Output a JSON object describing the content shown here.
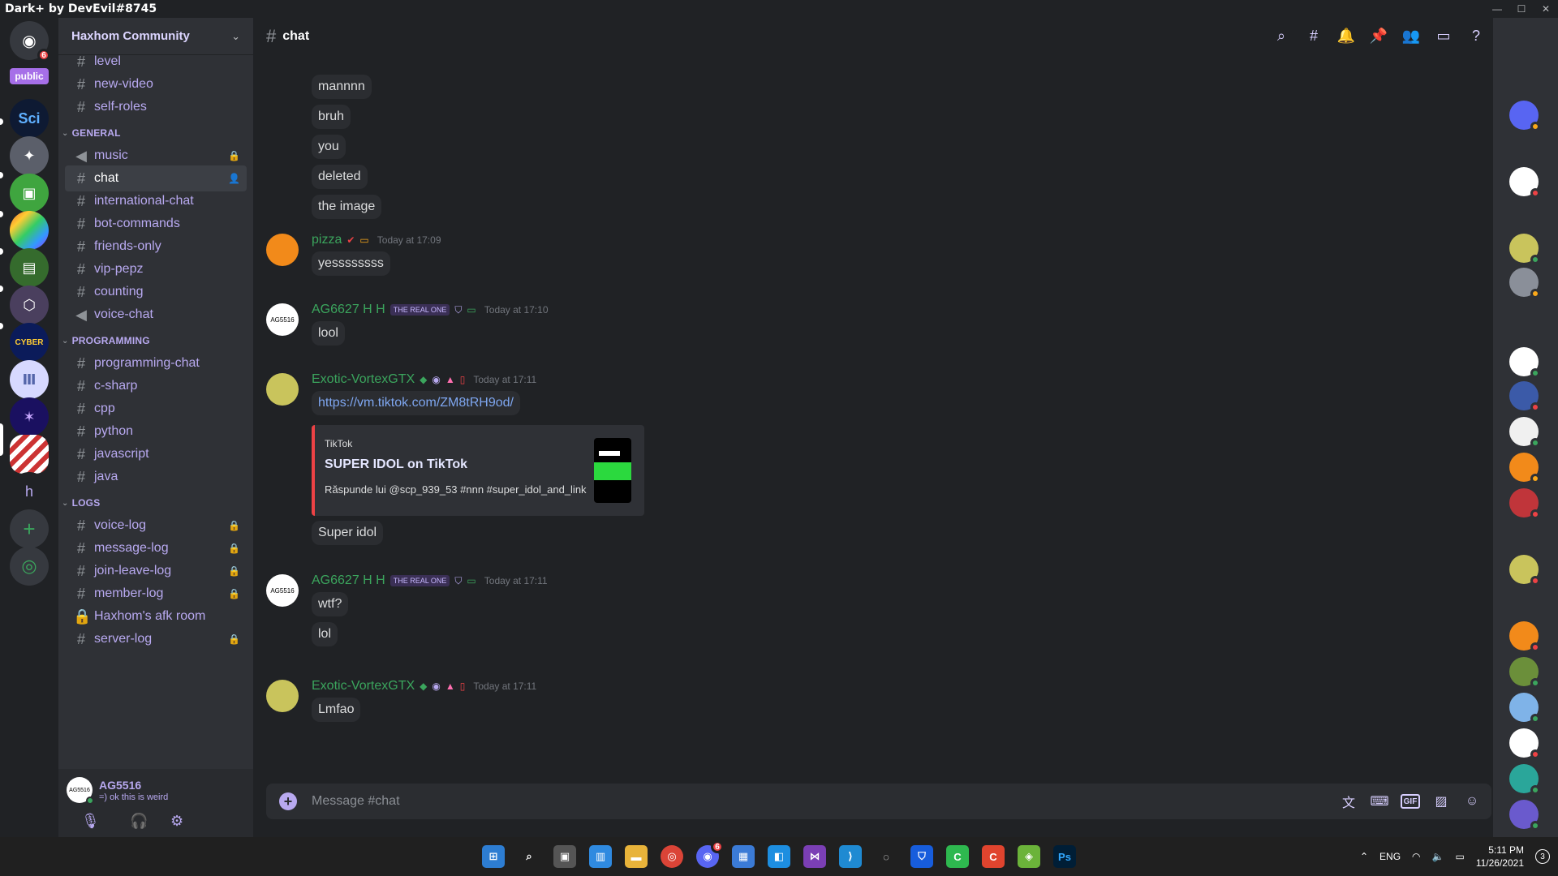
{
  "window": {
    "title": "Dark+ by DevEvil#8745"
  },
  "rail": {
    "home_badge": "6",
    "public_label": "public",
    "text_server_initial": "h",
    "add_label": "+",
    "explore_label": "◎"
  },
  "sidebar": {
    "guild_name": "Haxhom Community",
    "top_channels": [
      "level",
      "new-video",
      "self-roles"
    ],
    "categories": [
      {
        "name": "GENERAL"
      },
      {
        "name": "PROGRAMMING"
      },
      {
        "name": "LOGS"
      }
    ],
    "general": [
      "music",
      "chat",
      "international-chat",
      "bot-commands",
      "friends-only",
      "vip-pepz",
      "counting",
      "voice-chat"
    ],
    "programming": [
      "programming-chat",
      "c-sharp",
      "cpp",
      "python",
      "javascript",
      "java"
    ],
    "logs": [
      "voice-log",
      "message-log",
      "join-leave-log",
      "member-log",
      "Haxhom's afk room",
      "server-log"
    ]
  },
  "user": {
    "name": "AG5516",
    "status": "=) ok this is weird",
    "avatar_text": "AG5516"
  },
  "chat": {
    "channel_name": "chat",
    "bubbles_top": [
      "mannnn",
      "bruh",
      "you",
      "deleted",
      "the image"
    ],
    "msg_pizza": {
      "author": "pizza",
      "time": "Today at 17:09",
      "text": "yessssssss"
    },
    "msg_ag1": {
      "author": "AG6627 H H",
      "tag": "THE REAL ONE",
      "time": "Today at 17:10",
      "text": "lool",
      "avatar_text": "AG5516"
    },
    "msg_exotic1": {
      "author": "Exotic-VortexGTX",
      "time": "Today at 17:11",
      "link": "https://vm.tiktok.com/ZM8tRH9od/",
      "embed": {
        "provider": "TikTok",
        "title": "SUPER IDOL on TikTok",
        "description": "Răspunde lui @scp_939_53 #nnn #super_idol_and_link"
      },
      "text2": "Super idol"
    },
    "msg_ag2": {
      "author": "AG6627 H H",
      "tag": "THE REAL ONE",
      "time": "Today at 17:11",
      "lines": [
        "wtf?",
        "lol"
      ],
      "avatar_text": "AG5516"
    },
    "msg_exotic2": {
      "author": "Exotic-VortexGTX",
      "time": "Today at 17:11",
      "text": "Lmfao"
    },
    "composer_placeholder": "Message #chat"
  },
  "taskbar": {
    "lang": "ENG",
    "time": "5:11 PM",
    "date": "11/26/2021",
    "notif_count": "3",
    "discord_badge": "6"
  },
  "colors": {
    "accent": "#b8a9f0",
    "online": "#3ba55d",
    "dnd": "#ed4245",
    "idle": "#faa81a"
  }
}
